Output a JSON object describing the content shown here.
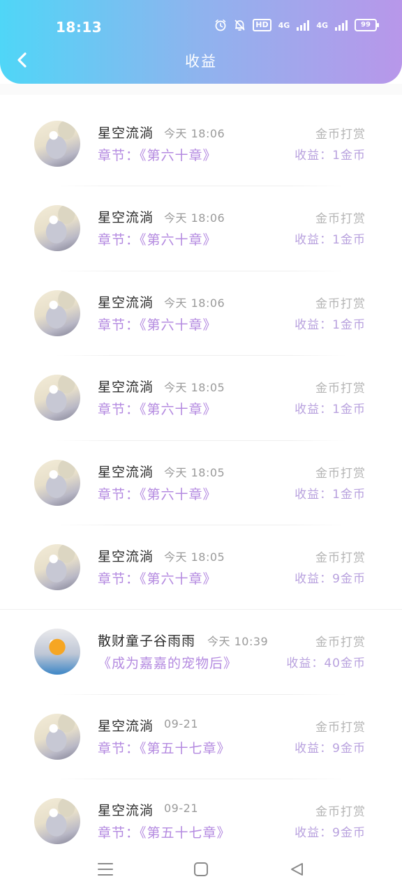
{
  "status_bar": {
    "time": "18:13",
    "network_1": "4G",
    "network_2": "4G",
    "hd_label": "HD",
    "battery": "99"
  },
  "header": {
    "title": "收益",
    "back_icon": "chevron-left-icon"
  },
  "records": [
    {
      "name": "星空流淌",
      "time": "今天 18:06",
      "chapter": "章节：《第六十章》",
      "type": "金币打赏",
      "earning": "收益：1金币",
      "avatar": "anime-girl-avatar"
    },
    {
      "name": "星空流淌",
      "time": "今天 18:06",
      "chapter": "章节：《第六十章》",
      "type": "金币打赏",
      "earning": "收益：1金币",
      "avatar": "anime-girl-avatar"
    },
    {
      "name": "星空流淌",
      "time": "今天 18:06",
      "chapter": "章节：《第六十章》",
      "type": "金币打赏",
      "earning": "收益：1金币",
      "avatar": "anime-girl-avatar"
    },
    {
      "name": "星空流淌",
      "time": "今天 18:05",
      "chapter": "章节：《第六十章》",
      "type": "金币打赏",
      "earning": "收益：1金币",
      "avatar": "anime-girl-avatar"
    },
    {
      "name": "星空流淌",
      "time": "今天 18:05",
      "chapter": "章节：《第六十章》",
      "type": "金币打赏",
      "earning": "收益：1金币",
      "avatar": "anime-girl-avatar"
    },
    {
      "name": "星空流淌",
      "time": "今天 18:05",
      "chapter": "章节：《第六十章》",
      "type": "金币打赏",
      "earning": "收益：9金币",
      "avatar": "anime-girl-avatar"
    },
    {
      "name": "散财童子谷雨雨",
      "time": "今天 10:39",
      "chapter": "《成为嘉嘉的宠物后》",
      "type": "金币打赏",
      "earning": "收益：40金币",
      "avatar": "cartoon-duck-avatar"
    },
    {
      "name": "星空流淌",
      "time": "09-21",
      "chapter": "章节：《第五十七章》",
      "type": "金币打赏",
      "earning": "收益：9金币",
      "avatar": "anime-girl-avatar"
    },
    {
      "name": "星空流淌",
      "time": "09-21",
      "chapter": "章节：《第五十七章》",
      "type": "金币打赏",
      "earning": "收益：9金币",
      "avatar": "anime-girl-avatar"
    }
  ],
  "nav_bar": {
    "menu_icon": "menu-icon",
    "home_icon": "home-square-icon",
    "back_icon": "back-triangle-icon"
  },
  "colors": {
    "header_gradient_start": "#4fd6f7",
    "header_gradient_end": "#b897ea",
    "accent_purple": "#b48ae0",
    "muted_text": "#b4b4b4"
  }
}
